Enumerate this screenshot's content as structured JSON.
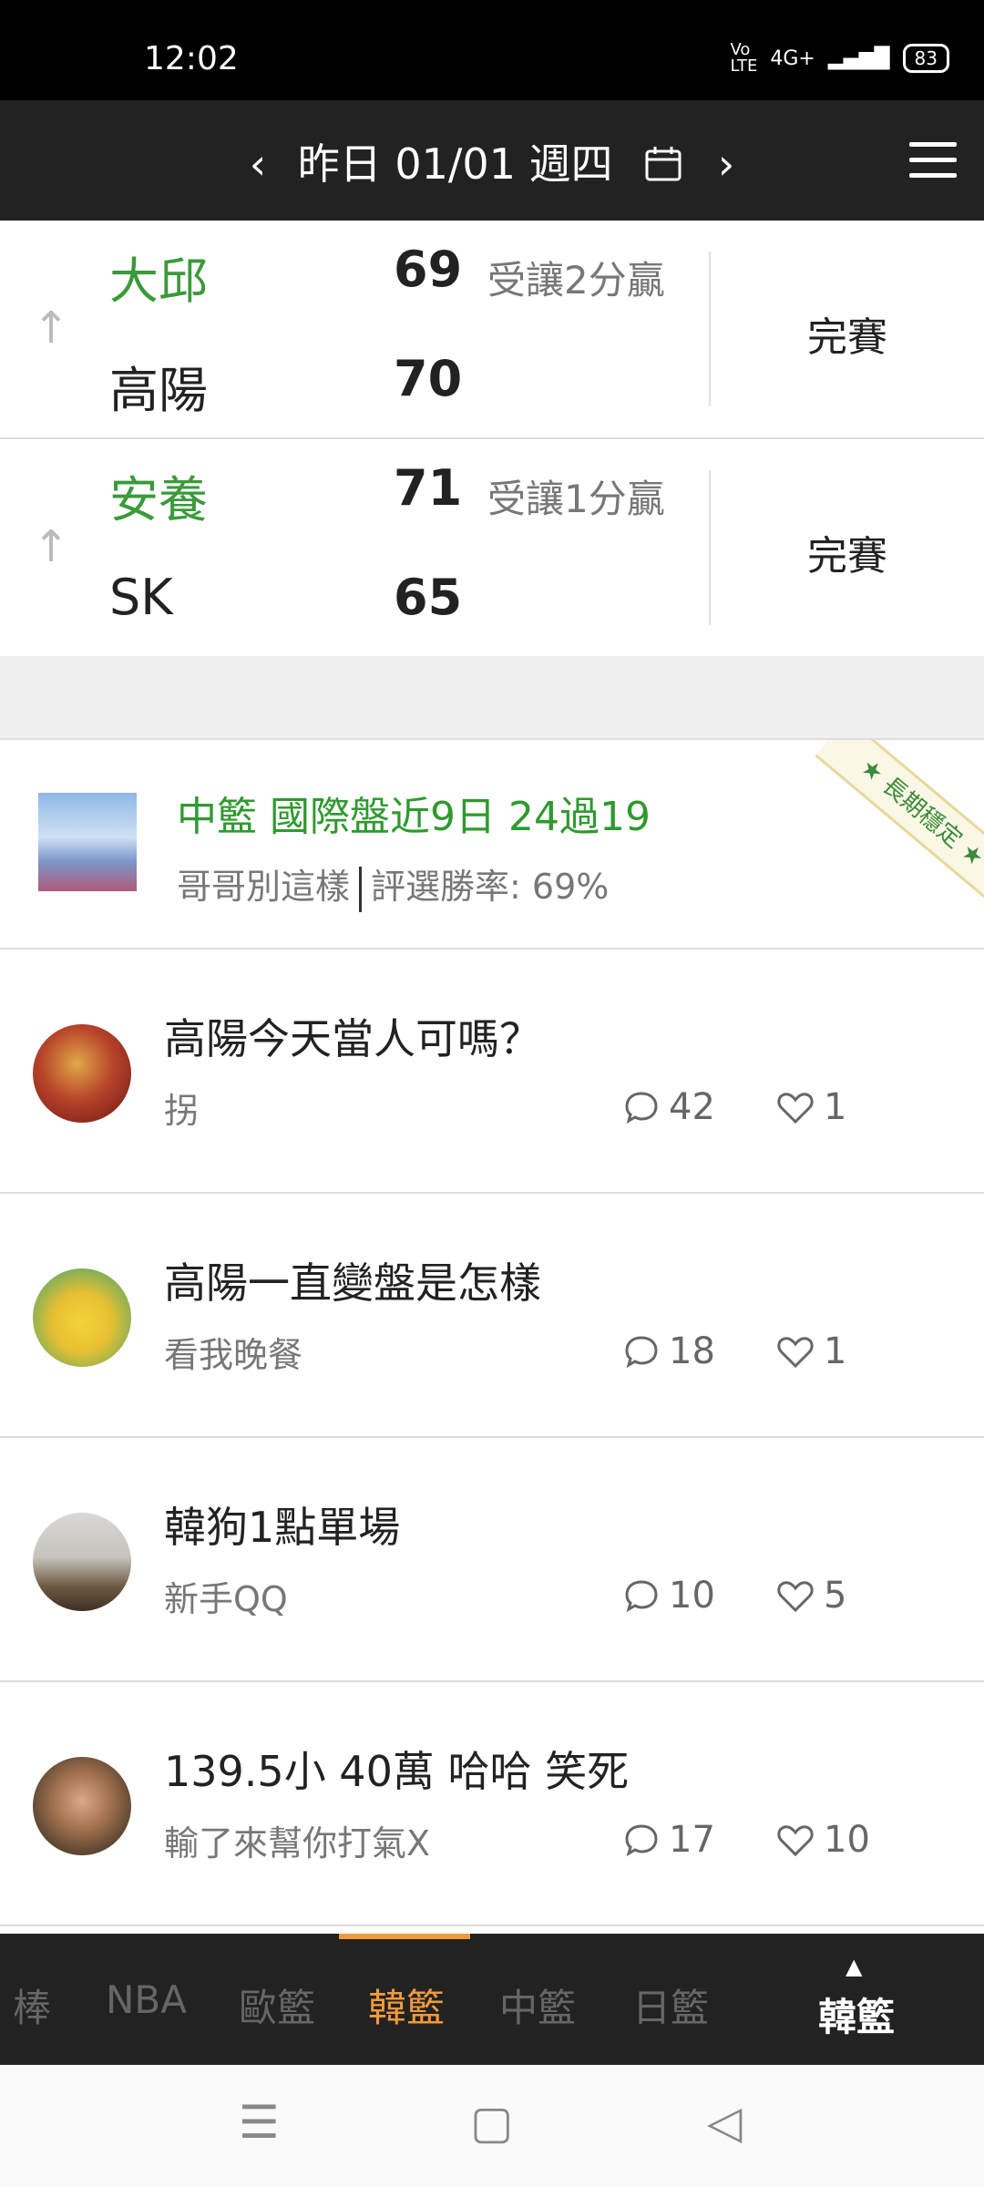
{
  "status_bar": {
    "time": "12:02",
    "network": "4G+",
    "battery": "83"
  },
  "header": {
    "prev_label": "‹",
    "date_label": "昨日 01/01 週四",
    "next_label": "›"
  },
  "matches": [
    {
      "team1": "大邱",
      "score1": "69",
      "note": "受讓2分贏",
      "team2": "高陽",
      "score2": "70",
      "status": "完賽"
    },
    {
      "team1": "安養",
      "score1": "71",
      "note": "受讓1分贏",
      "team2": "SK",
      "score2": "65",
      "status": "完賽"
    }
  ],
  "promo": {
    "title": "中籃 國際盤近9日 24過19",
    "author": "哥哥別這樣",
    "rate": "評選勝率: 69%",
    "badge": "長期穩定"
  },
  "posts": [
    {
      "title": "高陽今天當人可嗎？",
      "author": "拐",
      "comments": "42",
      "likes": "1"
    },
    {
      "title": "高陽一直變盤是怎樣",
      "author": "看我晚餐",
      "comments": "18",
      "likes": "1"
    },
    {
      "title": "韓狗1點單場",
      "author": "新手QQ",
      "comments": "10",
      "likes": "5"
    },
    {
      "title": "139.5小 40萬 哈哈 笑死",
      "author": "輸了來幫你打氣X",
      "comments": "17",
      "likes": "10"
    }
  ],
  "tabs": [
    "棒",
    "NBA",
    "歐籃",
    "韓籃",
    "中籃",
    "日籃"
  ],
  "tab_current": "韓籃",
  "colors": {
    "accent": "#f29a3b",
    "green": "#3a9a3a",
    "dark": "#222222"
  }
}
